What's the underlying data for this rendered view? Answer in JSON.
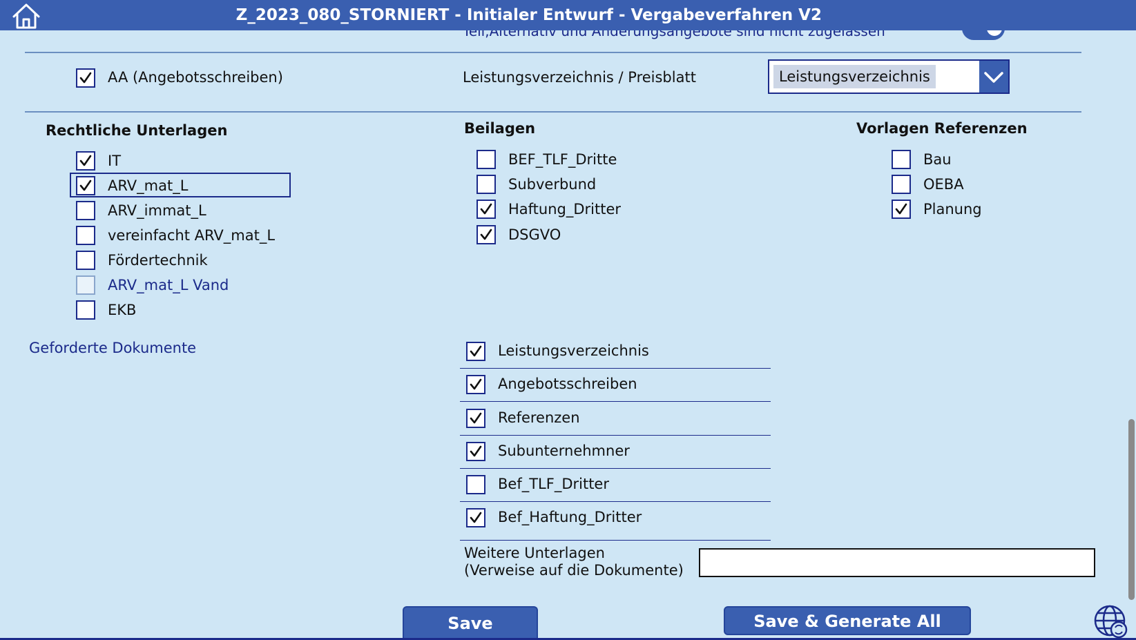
{
  "header": {
    "title": "Z_2023_080_STORNIERT  -  Initialer Entwurf  -  Vergabeverfahren V2",
    "home_icon": "home-icon"
  },
  "cutoff_text": "Teil,Alternativ und Änderungsangebote sind nicht zugelassen",
  "toggle_on": true,
  "aa_checkbox": {
    "label": "AA (Angebotsschreiben)",
    "checked": true
  },
  "leistung": {
    "label": "Leistungsverzeichnis / Preisblatt",
    "selected": "Leistungsverzeichnis"
  },
  "rechtliche": {
    "heading": "Rechtliche Unterlagen",
    "items": [
      {
        "label": "IT",
        "checked": true
      },
      {
        "label": "ARV_mat_L",
        "checked": true
      },
      {
        "label": "ARV_immat_L",
        "checked": false
      },
      {
        "label": "vereinfacht ARV_mat_L",
        "checked": false
      },
      {
        "label": "Fördertechnik",
        "checked": false
      },
      {
        "label": "ARV_mat_L Vand",
        "checked": false
      },
      {
        "label": "EKB",
        "checked": false
      }
    ]
  },
  "beilagen": {
    "heading": "Beilagen",
    "items": [
      {
        "label": "BEF_TLF_Dritte",
        "checked": false
      },
      {
        "label": "Subverbund",
        "checked": false
      },
      {
        "label": "Haftung_Dritter",
        "checked": true
      },
      {
        "label": "DSGVO",
        "checked": true
      }
    ]
  },
  "vorlagen": {
    "heading": "Vorlagen Referenzen",
    "items": [
      {
        "label": "Bau",
        "checked": false
      },
      {
        "label": "OEBA",
        "checked": false
      },
      {
        "label": "Planung",
        "checked": true
      }
    ]
  },
  "geforderte": {
    "label": "Geforderte Dokumente",
    "items": [
      {
        "label": "Leistungsverzeichnis",
        "checked": true
      },
      {
        "label": "Angebotsschreiben",
        "checked": true
      },
      {
        "label": "Referenzen",
        "checked": true
      },
      {
        "label": "Subunternehmner",
        "checked": true
      },
      {
        "label": "Bef_TLF_Dritter",
        "checked": false
      },
      {
        "label": "Bef_Haftung_Dritter",
        "checked": true
      }
    ]
  },
  "weitere": {
    "label_line1": "Weitere Unterlagen",
    "label_line2": "(Verweise auf die Dokumente)",
    "value": ""
  },
  "buttons": {
    "save": "Save",
    "save_generate": "Save & Generate All"
  },
  "colors": {
    "header": "#3a5fb0",
    "background": "#cfe6f5",
    "accent_dark": "#1b2a8a"
  }
}
